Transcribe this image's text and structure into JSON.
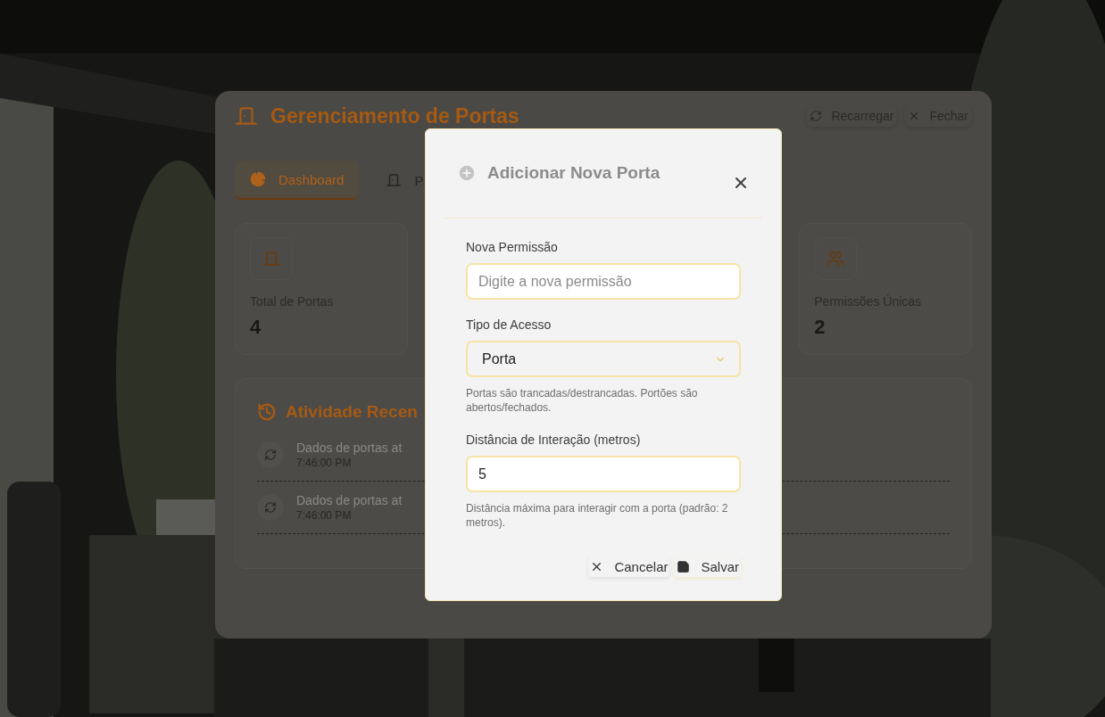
{
  "panel": {
    "title": "Gerenciamento de Portas",
    "actions": [
      {
        "label": "Recarregar",
        "kind": "reload"
      },
      {
        "label": "Fechar",
        "kind": "close"
      }
    ],
    "tabs": [
      {
        "label": "Dashboard",
        "selected": true,
        "kind": "chart"
      },
      {
        "label": "P",
        "selected": false,
        "kind": "door"
      }
    ],
    "stats": [
      {
        "label": "Total de Portas",
        "value": "4",
        "kind": "door"
      },
      {
        "label": "Permissões Únicas",
        "value": "2",
        "kind": "users"
      }
    ],
    "activity": {
      "title": "Atividade Recen",
      "items": [
        {
          "text": "Dados de portas at",
          "time": "7:46:00 PM"
        },
        {
          "text": "Dados de portas at",
          "time": "7:46:00 PM"
        }
      ]
    }
  },
  "modal": {
    "title": "Adicionar Nova Porta",
    "fields": [
      {
        "kind": "text",
        "label": "Nova Permissão",
        "placeholder": "Digite a nova permissão"
      },
      {
        "kind": "select",
        "label": "Tipo de Acesso",
        "value": "Porta",
        "hint": "Portas são trancadas/destrancadas. Portões são abertos/fechados."
      },
      {
        "kind": "number",
        "label": "Distância de Interação (metros)",
        "value": "5",
        "hint": "Distância máxima para interagir com a porta (padrão: 2 metros)."
      }
    ],
    "buttons": [
      {
        "label": "Cancelar",
        "kind": "cancel"
      },
      {
        "label": "Salvar",
        "kind": "save"
      }
    ]
  }
}
